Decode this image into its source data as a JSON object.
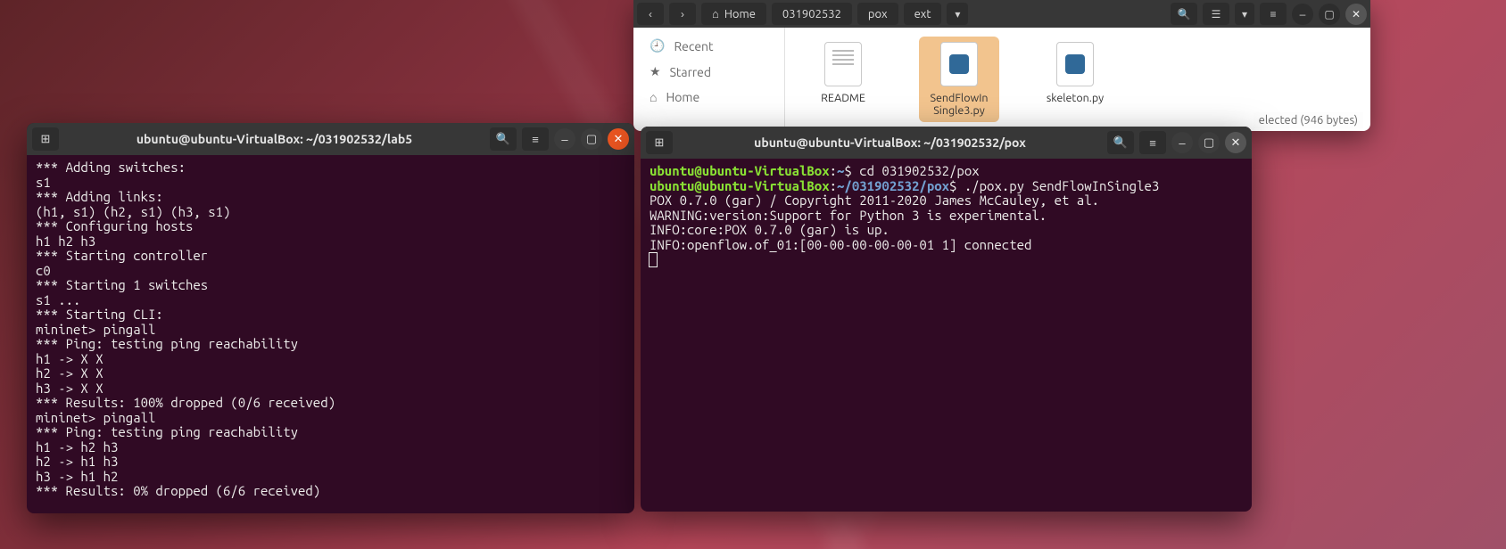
{
  "fileManager": {
    "nav": {
      "back": "‹",
      "fwd": "›"
    },
    "breadcrumb": {
      "home": "Home",
      "seg1": "031902532",
      "seg2": "pox",
      "seg3": "ext",
      "chev": "▾"
    },
    "sidebar": {
      "recent": "Recent",
      "starred": "Starred",
      "home": "Home"
    },
    "files": {
      "readme": "README",
      "send_l1": "SendFlowIn",
      "send_l2": "Single3.py",
      "skeleton": "skeleton.py"
    },
    "status": "elected  (946 bytes)"
  },
  "termLeft": {
    "title": "ubuntu@ubuntu-VirtualBox: ~/031902532/lab5",
    "lines": {
      "l0": "*** Adding switches:",
      "l1": "s1",
      "l2": "*** Adding links:",
      "l3": "(h1, s1) (h2, s1) (h3, s1)",
      "l4": "*** Configuring hosts",
      "l5": "h1 h2 h3",
      "l6": "*** Starting controller",
      "l7": "c0",
      "l8": "*** Starting 1 switches",
      "l9": "s1 ...",
      "l10": "*** Starting CLI:",
      "l11": "mininet> pingall",
      "l12": "*** Ping: testing ping reachability",
      "l13": "h1 -> X X",
      "l14": "h2 -> X X",
      "l15": "h3 -> X X",
      "l16": "*** Results: 100% dropped (0/6 received)",
      "l17": "mininet> pingall",
      "l18": "*** Ping: testing ping reachability",
      "l19": "h1 -> h2 h3",
      "l20": "h2 -> h1 h3",
      "l21": "h3 -> h1 h2",
      "l22": "*** Results: 0% dropped (6/6 received)"
    }
  },
  "termRight": {
    "title": "ubuntu@ubuntu-VirtualBox: ~/031902532/pox",
    "p1_user": "ubuntu@ubuntu-VirtualBox",
    "p1_colon": ":",
    "p1_path": "~",
    "p1_dollar": "$ ",
    "p1_cmd": "cd 031902532/pox",
    "p2_user": "ubuntu@ubuntu-VirtualBox",
    "p2_colon": ":",
    "p2_path": "~/031902532/pox",
    "p2_dollar": "$ ",
    "p2_cmd": "./pox.py SendFlowInSingle3",
    "o1": "POX 0.7.0 (gar) / Copyright 2011-2020 James McCauley, et al.",
    "o2": "WARNING:version:Support for Python 3 is experimental.",
    "o3": "INFO:core:POX 0.7.0 (gar) is up.",
    "o4": "INFO:openflow.of_01:[00-00-00-00-00-01 1] connected"
  }
}
